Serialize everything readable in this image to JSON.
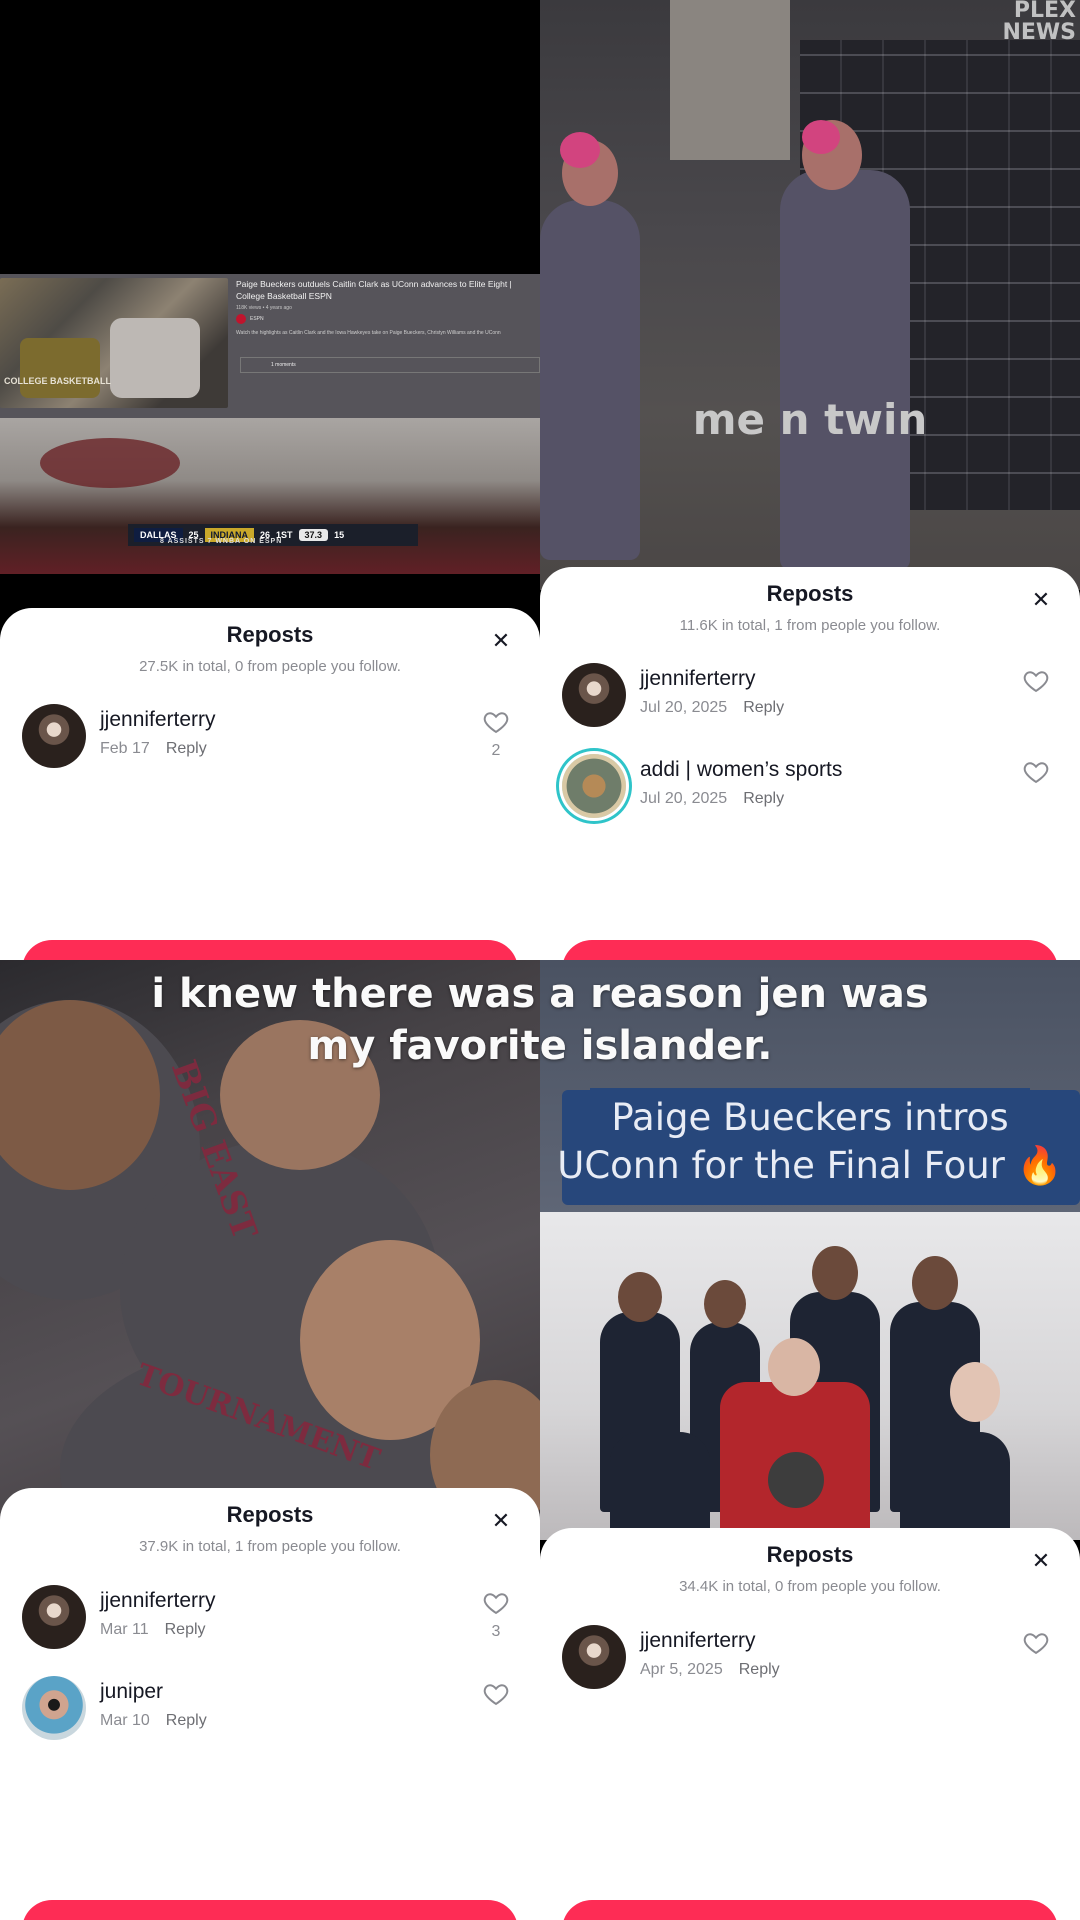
{
  "overlay_caption": {
    "line1": "i knew there was a reason jen was",
    "line2": "my favorite islander."
  },
  "panels": [
    {
      "video": {
        "yt_title": "Paige Bueckers outduels Caitlin Clark as UConn advances to Elite Eight | College Basketball ESPN",
        "yt_meta": "118K views • 4 years ago",
        "yt_channel": "ESPN",
        "yt_desc": "Watch the highlights as Caitlin Clark and the Iowa Hawkeyes take on Paige Bueckers, Christyn Williams and the UConn",
        "yt_moments": "1 moments",
        "thumb_badge": "COLLEGE BASKETBALL",
        "score": {
          "team1": "DALLAS",
          "score1": "25",
          "team2": "INDIANA",
          "score2": "26",
          "period": "1ST",
          "clock": "37.3",
          "shot": "15",
          "stat_line": "8   ASSISTS   7   WNBA ON ESPN"
        }
      },
      "sheet": {
        "title": "Reposts",
        "subtitle": "27.5K in total, 0 from people you follow.",
        "rows": [
          {
            "name": "jjenniferterry",
            "date": "Feb 17",
            "reply": "Reply",
            "likes": "2"
          }
        ]
      }
    },
    {
      "video": {
        "watermark_line1": "PLEX",
        "watermark_line2": "NEWS",
        "caption": "me n twin"
      },
      "sheet": {
        "title": "Reposts",
        "subtitle": "11.6K in total, 1 from people you follow.",
        "rows": [
          {
            "name": "jjenniferterry",
            "date": "Jul 20, 2025",
            "reply": "Reply",
            "likes": ""
          },
          {
            "name": "addi | women’s sports",
            "date": "Jul 20, 2025",
            "reply": "Reply",
            "likes": ""
          }
        ]
      }
    },
    {
      "video": {
        "shirt_text1": "BIG EAST",
        "shirt_text2": "TOURNAMENT"
      },
      "sheet": {
        "title": "Reposts",
        "subtitle": "37.9K in total, 1 from people you follow.",
        "rows": [
          {
            "name": "jjenniferterry",
            "date": "Mar 11",
            "reply": "Reply",
            "likes": "3"
          },
          {
            "name": "juniper",
            "date": "Mar 10",
            "reply": "Reply",
            "likes": ""
          }
        ]
      }
    },
    {
      "video": {
        "banner_line1": "Paige Bueckers intros",
        "banner_line2": "UConn for the Final Four 🔥"
      },
      "sheet": {
        "title": "Reposts",
        "subtitle": "34.4K in total, 0 from people you follow.",
        "rows": [
          {
            "name": "jjenniferterry",
            "date": "Apr 5, 2025",
            "reply": "Reply",
            "likes": ""
          }
        ]
      }
    }
  ],
  "colors": {
    "accent": "#fe2c55",
    "ring": "#2fc4c9",
    "sheet_bg": "#ffffff",
    "muted": "#8a8b91"
  },
  "icons": {
    "close": "close-icon",
    "like": "heart-icon"
  }
}
